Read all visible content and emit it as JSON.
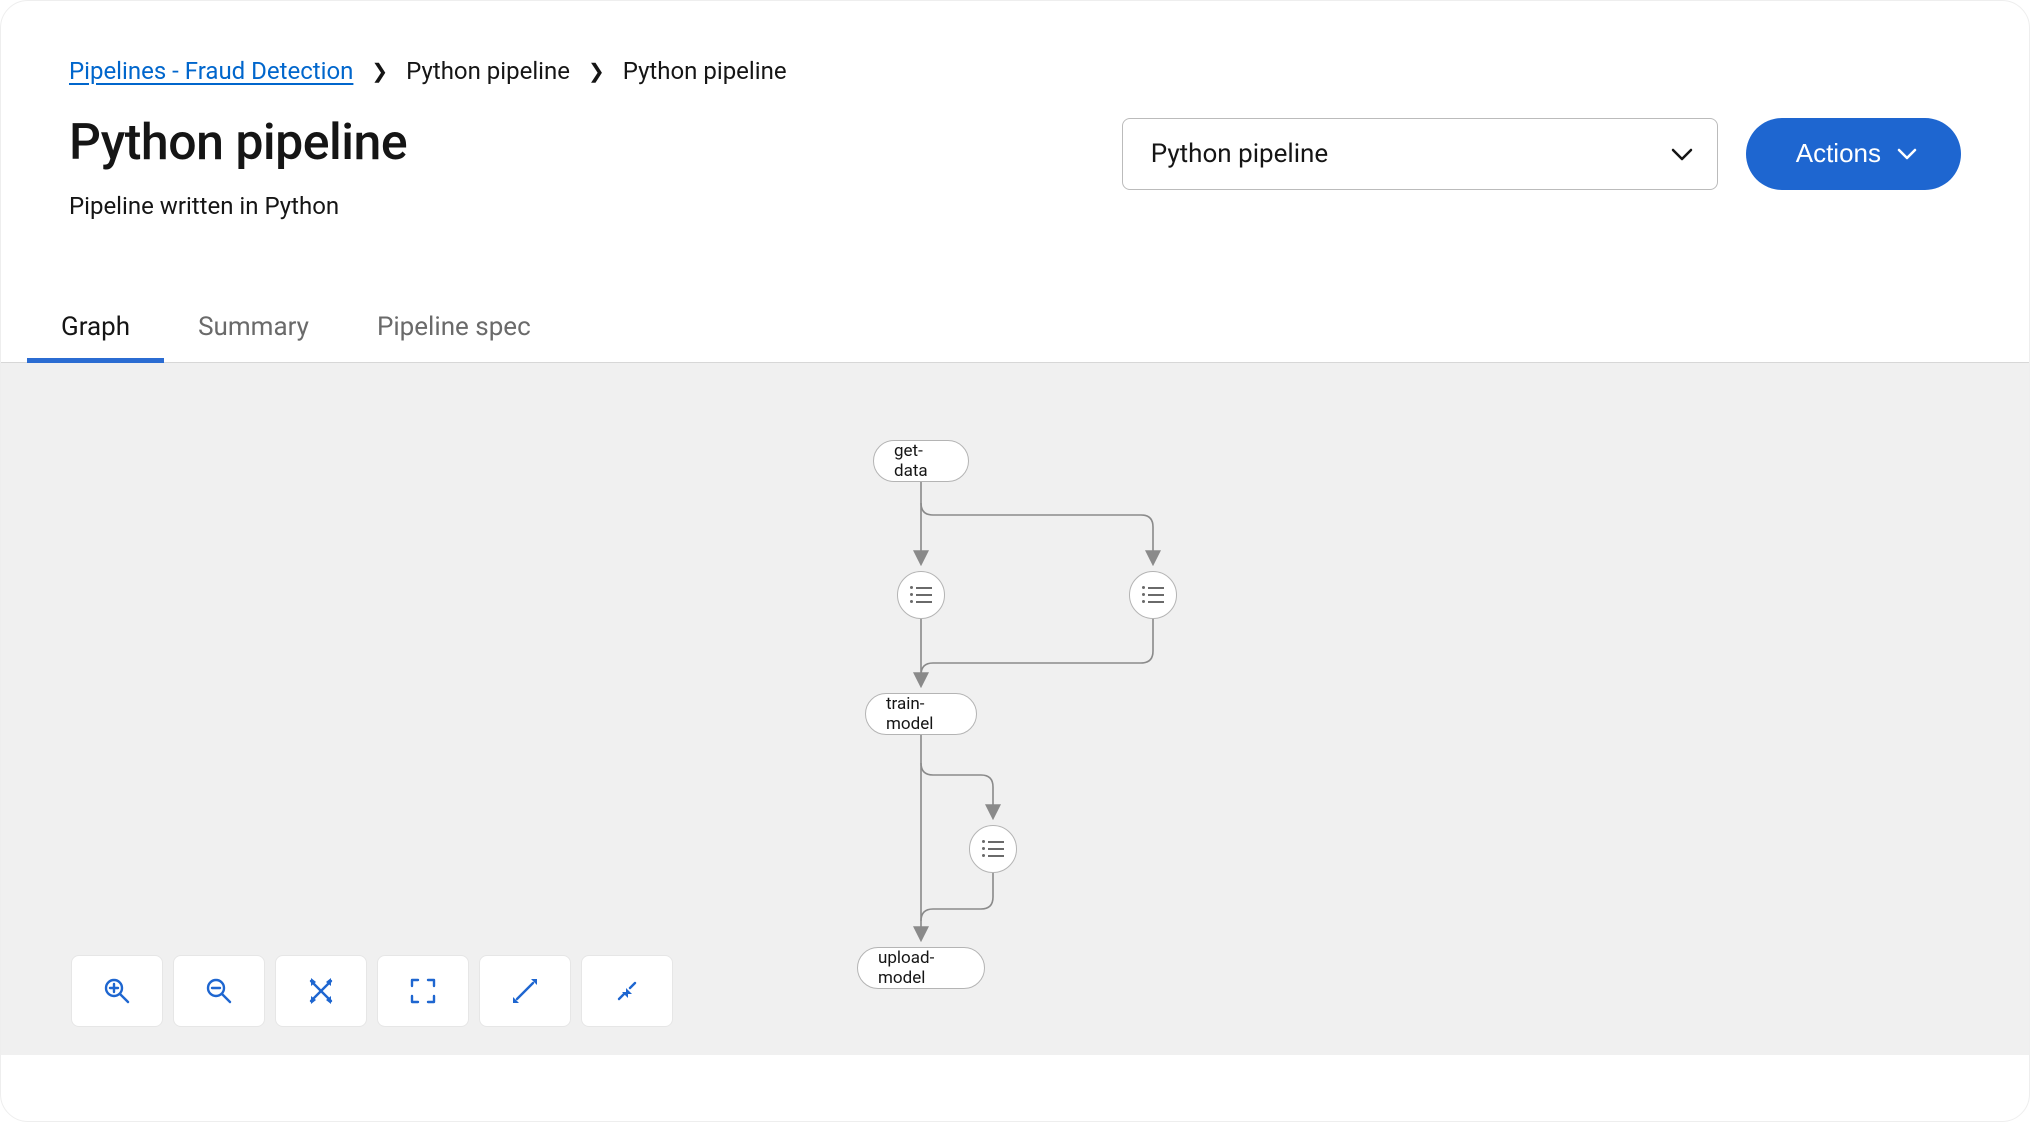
{
  "breadcrumb": {
    "root": "Pipelines - Fraud Detection",
    "mid": "Python pipeline",
    "leaf": "Python pipeline"
  },
  "header": {
    "title": "Python pipeline",
    "subtitle": "Pipeline written in Python"
  },
  "select": {
    "value": "Python pipeline"
  },
  "actions": {
    "label": "Actions"
  },
  "tabs": {
    "graph": "Graph",
    "summary": "Summary",
    "spec": "Pipeline spec"
  },
  "nodes": {
    "get_data": "get-data",
    "train_model": "train-model",
    "upload_model": "upload-model"
  },
  "toolbar": {
    "zoom_in": "zoom-in",
    "zoom_out": "zoom-out",
    "fit": "fit",
    "fullscreen": "fullscreen",
    "expand": "expand",
    "collapse": "collapse"
  }
}
